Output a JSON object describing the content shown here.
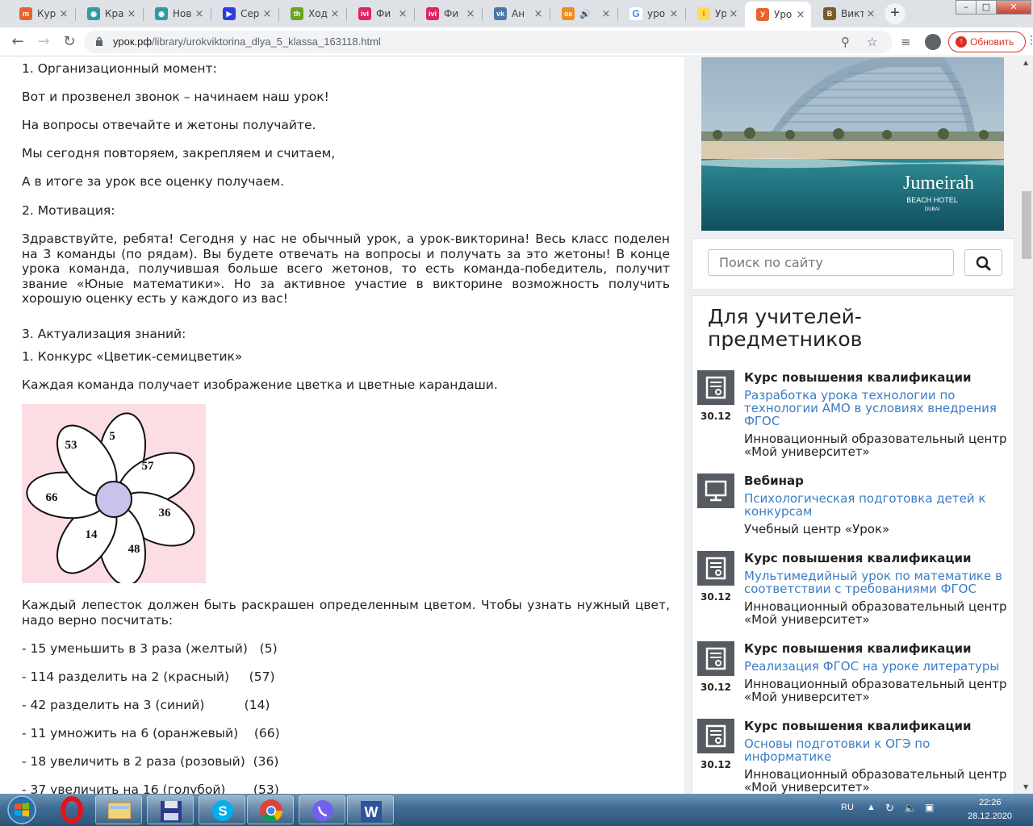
{
  "tabs": [
    {
      "title": "Кур",
      "favicon": "урок-favicon",
      "color": "#e8632c",
      "glyph": "m"
    },
    {
      "title": "Кра",
      "favicon": "owl-favicon",
      "color": "#2f9aa0",
      "glyph": "◉"
    },
    {
      "title": "Нов",
      "favicon": "owl-favicon",
      "color": "#2f9aa0",
      "glyph": "◉"
    },
    {
      "title": "Сер",
      "favicon": "play-favicon",
      "color": "#2b3ce0",
      "glyph": "▶"
    },
    {
      "title": "Ход",
      "favicon": "th-favicon",
      "color": "#6aa31c",
      "glyph": "th"
    },
    {
      "title": "Фи",
      "favicon": "ivi-favicon",
      "color": "#e0245e",
      "glyph": "ivi"
    },
    {
      "title": "Фи",
      "favicon": "ivi-favicon",
      "color": "#e0245e",
      "glyph": "ivi"
    },
    {
      "title": "Ан",
      "favicon": "vk-favicon",
      "color": "#4a76a8",
      "glyph": "vk"
    },
    {
      "title": "",
      "favicon": "ok-favicon",
      "color": "#f28b1d",
      "glyph": "ок",
      "audio": true
    },
    {
      "title": "уро",
      "favicon": "google-favicon",
      "color": "#ffffff",
      "glyph": "G"
    },
    {
      "title": "Уро",
      "favicon": "yandex-favicon",
      "color": "#ffdb4d",
      "glyph": "I"
    },
    {
      "title": "Уро",
      "favicon": "urok-favicon",
      "color": "#e8632c",
      "glyph": "У",
      "active": true
    },
    {
      "title": "Викто",
      "favicon": "viktorina-favicon",
      "color": "#7a5a2a",
      "glyph": "В"
    }
  ],
  "address": {
    "domain": "урок.рф",
    "path": "/library/urokviktorina_dlya_5_klassa_163118.html",
    "update_label": "Обновить"
  },
  "article": {
    "paragraphs": [
      "1. Организационный момент:",
      "Вот и прозвенел звонок – начинаем наш урок!",
      "На вопросы отвечайте и жетоны получайте.",
      "Мы сегодня повторяем, закрепляем и считаем,",
      "А в итоге за урок все оценку получаем.",
      "2. Мотивация:",
      "Здравствуйте, ребята! Сегодня у нас не обычный урок, а урок-викторина! Весь класс поделен на 3 команды (по рядам). Вы будете отвечать на вопросы и получать за это жетоны! В конце урока команда, получившая больше всего жетонов, то есть команда-победитель, получит звание «Юные математики». Но за активное участие в викторине возможность получить хорошую оценку есть у каждого из вас!",
      "3. Актуализация знаний:",
      "1. Конкурс «Цветик-семицветик»",
      "Каждая команда получает изображение цветка и цветные карандаши.",
      "Каждый лепесток должен быть раскрашен определенным цветом. Чтобы узнать нужный цвет, надо верно посчитать:",
      "- 15 уменьшить в 3 раза (желтый)   (5)",
      "- 114 разделить на 2 (красный)     (57)",
      "- 42 разделить на 3 (синий)          (14)",
      "- 11 умножить на 6 (оранжевый)    (66)",
      "- 18 увеличить в 2 раза (розовый)  (36)",
      "- 37 увеличить на 16 (голубой)       (53)"
    ],
    "flower_numbers": [
      "5",
      "57",
      "36",
      "48",
      "14",
      "66",
      "53"
    ]
  },
  "ad": {
    "brand": "Jumeirah",
    "line2": "BEACH HOTEL",
    "line3": "DUBAI"
  },
  "search": {
    "placeholder": "Поиск по сайту"
  },
  "sidebar": {
    "title": "Для учителей-предметников",
    "courses": [
      {
        "kind": "Курс повышения квалификации",
        "title": "Разработка урока технологии по технологии АМО в условиях внедрения ФГОС",
        "org": "Инновационный образовательный центр «Мой университет»",
        "date": "30.12",
        "icon": "certificate-icon"
      },
      {
        "kind": "Вебинар",
        "title": "Психологическая подготовка детей к конкурсам",
        "org": "Учебный центр «Урок»",
        "date": "",
        "icon": "monitor-icon"
      },
      {
        "kind": "Курс повышения квалификации",
        "title": "Мультимедийный урок по математике в соответствии с требованиями ФГОС",
        "org": "Инновационный образовательный центр «Мой университет»",
        "date": "30.12",
        "icon": "certificate-icon"
      },
      {
        "kind": "Курс повышения квалификации",
        "title": "Реализация ФГОС на уроке литературы",
        "org": "Инновационный образовательный центр «Мой университет»",
        "date": "30.12",
        "icon": "certificate-icon"
      },
      {
        "kind": "Курс повышения квалификации",
        "title": "Основы подготовки к ОГЭ по информатике",
        "org": "Инновационный образовательный центр «Мой университет»",
        "date": "30.12",
        "icon": "certificate-icon"
      }
    ]
  },
  "taskbar": {
    "apps": [
      "opera-icon",
      "file-explorer-icon",
      "save-disk-icon",
      "skype-icon",
      "chrome-icon",
      "viber-icon",
      "word-icon"
    ],
    "lang": "RU",
    "time": "22:26",
    "date": "28.12.2020"
  }
}
